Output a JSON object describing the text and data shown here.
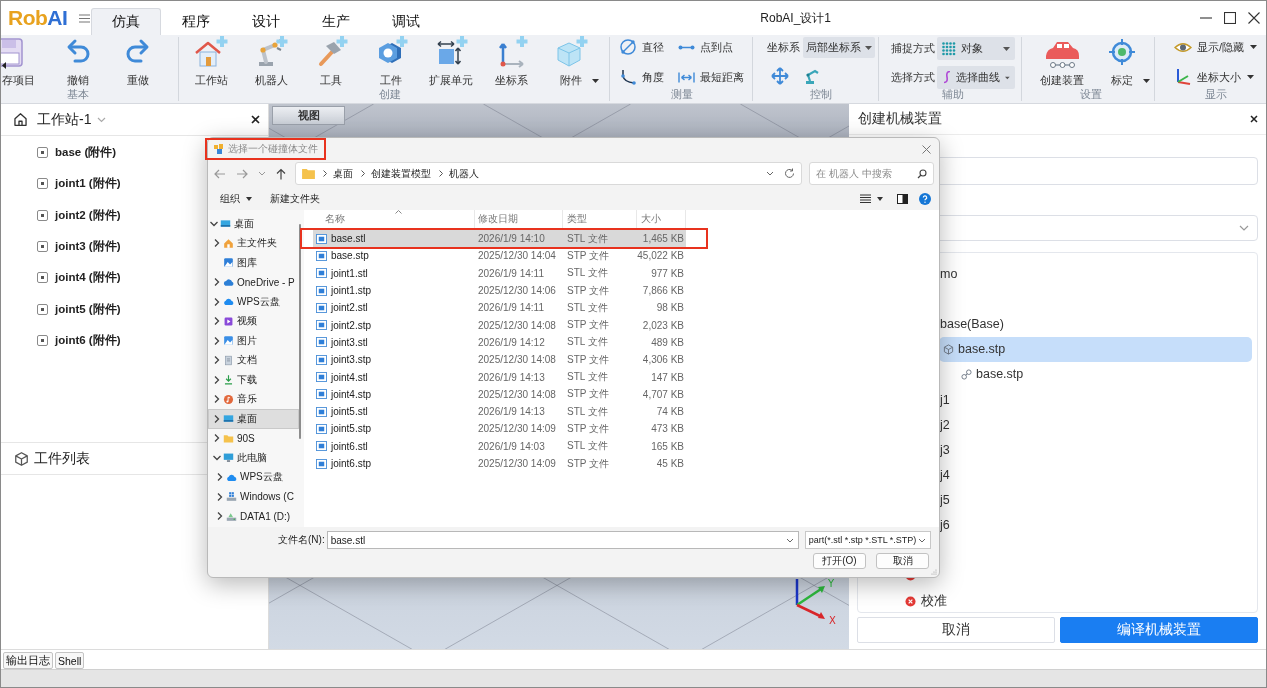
{
  "app": {
    "logo": [
      {
        "text": "Rob",
        "color": "#e8a21e"
      },
      {
        "text": "AI",
        "color": "#2f6fd4"
      }
    ],
    "title": "RobAI_设计1"
  },
  "menu_tabs": [
    {
      "label": "仿真",
      "selected": true
    },
    {
      "label": "程序",
      "selected": false
    },
    {
      "label": "设计",
      "selected": false
    },
    {
      "label": "生产",
      "selected": false
    },
    {
      "label": "调试",
      "selected": false
    }
  ],
  "ribbon": [
    {
      "label": "基本",
      "kind": "large",
      "items": [
        {
          "kind": "save",
          "label": "存项目"
        },
        {
          "kind": "undo",
          "label": "撤销"
        },
        {
          "kind": "redo",
          "label": "重做"
        }
      ]
    },
    {
      "label": "创建",
      "kind": "large",
      "items": [
        {
          "kind": "workstation",
          "label": "工作站",
          "dropdown": false
        },
        {
          "kind": "robot",
          "label": "机器人",
          "dropdown": false
        },
        {
          "kind": "tool",
          "label": "工具",
          "dropdown": false
        },
        {
          "kind": "workpiece",
          "label": "工件",
          "dropdown": false
        },
        {
          "kind": "extension",
          "label": "扩展单元",
          "dropdown": false
        },
        {
          "kind": "frame",
          "label": "坐标系",
          "dropdown": false
        },
        {
          "kind": "accessory",
          "label": "附件",
          "dropdown": true
        }
      ]
    },
    {
      "label": "测量",
      "kind": "grid",
      "items": [
        {
          "kind": "diameter",
          "label": "直径"
        },
        {
          "kind": "point",
          "label": "点到点"
        },
        {
          "kind": "angle",
          "label": "角度"
        },
        {
          "kind": "distance",
          "label": "最短距离"
        }
      ]
    },
    {
      "label": "控制",
      "kind": "control",
      "fields": [
        {
          "label": "坐标系",
          "value": "局部坐标系"
        }
      ],
      "items": [
        {
          "kind": "move"
        },
        {
          "kind": "robot-arm"
        }
      ]
    },
    {
      "label": "辅助",
      "kind": "fields",
      "fields": [
        {
          "label": "捕捉方式",
          "kind": "grid",
          "value": "对象"
        },
        {
          "label": "选择方式",
          "kind": "curve",
          "value": "选择曲线"
        }
      ]
    },
    {
      "label": "设置",
      "kind": "large",
      "items": [
        {
          "kind": "car",
          "label": "创建装置",
          "dropdown": false
        },
        {
          "kind": "target",
          "label": "标定",
          "dropdown": true
        }
      ]
    },
    {
      "label": "显示",
      "kind": "small",
      "items": [
        {
          "kind": "eye",
          "label": "显示/隐藏",
          "dropdown": true
        },
        {
          "kind": "axes",
          "label": "坐标大小",
          "dropdown": true
        }
      ]
    }
  ],
  "workstation": {
    "title": "工作站-1",
    "items": [
      {
        "label": "base (附件)"
      },
      {
        "label": "joint1 (附件)"
      },
      {
        "label": "joint2 (附件)"
      },
      {
        "label": "joint3 (附件)"
      },
      {
        "label": "joint4 (附件)"
      },
      {
        "label": "joint5 (附件)"
      },
      {
        "label": "joint6 (附件)"
      }
    ]
  },
  "parts_list": {
    "title": "工件列表"
  },
  "viewport": {
    "tab": "视图",
    "axes": {
      "y": "Y",
      "x": "X"
    }
  },
  "panel": {
    "title": "创建机械装置",
    "tree": [
      {
        "label": "mo",
        "selected": false,
        "children": [
          {
            "label": "base(Base)",
            "selected": false,
            "children": [
              {
                "label": "base.stp",
                "kind": "part",
                "selected": true,
                "children": [
                  {
                    "label": "base.stp",
                    "kind": "link",
                    "selected": false
                  }
                ]
              }
            ]
          },
          {
            "label": "j1",
            "selected": false
          },
          {
            "label": "j2",
            "selected": false
          },
          {
            "label": "j3",
            "selected": false
          },
          {
            "label": "j4",
            "selected": false
          },
          {
            "label": "j5",
            "selected": false
          },
          {
            "label": "j6",
            "selected": false
          }
        ]
      }
    ],
    "checks": [
      {
        "kind": "error"
      },
      {
        "label": "校准",
        "kind": "error"
      }
    ],
    "buttons": [
      {
        "label": "取消",
        "kind": "secondary"
      },
      {
        "label": "编译机械装置",
        "kind": "primary"
      }
    ]
  },
  "dialog": {
    "title": {
      "text": "选择一个碰撞体文件",
      "highlighted": true
    },
    "path": [
      "桌面",
      "创建装置模型",
      "机器人"
    ],
    "search": {
      "placeholder": "在 机器人 中搜索"
    },
    "toolbar": [
      {
        "label": "组织",
        "dropdown": true
      },
      {
        "label": "新建文件夹",
        "dropdown": false
      }
    ],
    "nav": [
      {
        "label": "桌面",
        "kind": "desktop",
        "expandable": true,
        "expanded": true,
        "selected": false,
        "children": [
          {
            "label": "主文件夹",
            "kind": "home",
            "expandable": true,
            "expanded": false,
            "selected": false
          },
          {
            "label": "图库",
            "kind": "gallery",
            "expandable": false,
            "selected": false
          },
          {
            "label": "OneDrive - P",
            "kind": "onedrive",
            "expandable": true,
            "expanded": false,
            "selected": false
          },
          {
            "label": "WPS云盘",
            "kind": "wps",
            "expandable": true,
            "expanded": false,
            "selected": false
          },
          {
            "label": "视频",
            "kind": "video",
            "expandable": true,
            "expanded": false,
            "selected": false
          },
          {
            "label": "图片",
            "kind": "pictures",
            "expandable": true,
            "expanded": false,
            "selected": false
          },
          {
            "label": "文档",
            "kind": "documents",
            "expandable": true,
            "expanded": false,
            "selected": false
          },
          {
            "label": "下载",
            "kind": "downloads",
            "expandable": true,
            "expanded": false,
            "selected": false
          },
          {
            "label": "音乐",
            "kind": "music",
            "expandable": true,
            "expanded": false,
            "selected": false
          },
          {
            "label": "桌面",
            "kind": "desktop",
            "expandable": true,
            "expanded": false,
            "selected": true
          },
          {
            "label": "90S",
            "kind": "folder",
            "expandable": true,
            "expanded": false,
            "selected": false
          },
          {
            "label": "此电脑",
            "kind": "computer",
            "expandable": true,
            "expanded": true,
            "selected": false,
            "children": [
              {
                "label": "WPS云盘",
                "kind": "wps",
                "expandable": true,
                "expanded": false,
                "selected": false
              },
              {
                "label": "Windows (C",
                "kind": "system-drive",
                "expandable": true,
                "expanded": false,
                "selected": false
              },
              {
                "label": "DATA1 (D:)",
                "kind": "drive",
                "expandable": true,
                "expanded": false,
                "selected": false
              }
            ]
          }
        ]
      }
    ],
    "columns": [
      {
        "label": "名称",
        "sorted": true
      },
      {
        "label": "修改日期",
        "sorted": false
      },
      {
        "label": "类型",
        "sorted": false
      },
      {
        "label": "大小",
        "sorted": false
      }
    ],
    "files": [
      {
        "name": "base.stl",
        "date": "2026/1/9 14:10",
        "type": "STL 文件",
        "size": "1,465 KB",
        "selected": true,
        "highlighted": true
      },
      {
        "name": "base.stp",
        "date": "2025/12/30 14:04",
        "type": "STP 文件",
        "size": "45,022 KB",
        "selected": false,
        "highlighted": false
      },
      {
        "name": "joint1.stl",
        "date": "2026/1/9 14:11",
        "type": "STL 文件",
        "size": "977 KB",
        "selected": false,
        "highlighted": false
      },
      {
        "name": "joint1.stp",
        "date": "2025/12/30 14:06",
        "type": "STP 文件",
        "size": "7,866 KB",
        "selected": false,
        "highlighted": false
      },
      {
        "name": "joint2.stl",
        "date": "2026/1/9 14:11",
        "type": "STL 文件",
        "size": "98 KB",
        "selected": false,
        "highlighted": false
      },
      {
        "name": "joint2.stp",
        "date": "2025/12/30 14:08",
        "type": "STP 文件",
        "size": "2,023 KB",
        "selected": false,
        "highlighted": false
      },
      {
        "name": "joint3.stl",
        "date": "2026/1/9 14:12",
        "type": "STL 文件",
        "size": "489 KB",
        "selected": false,
        "highlighted": false
      },
      {
        "name": "joint3.stp",
        "date": "2025/12/30 14:08",
        "type": "STP 文件",
        "size": "4,306 KB",
        "selected": false,
        "highlighted": false
      },
      {
        "name": "joint4.stl",
        "date": "2026/1/9 14:13",
        "type": "STL 文件",
        "size": "147 KB",
        "selected": false,
        "highlighted": false
      },
      {
        "name": "joint4.stp",
        "date": "2025/12/30 14:08",
        "type": "STP 文件",
        "size": "4,707 KB",
        "selected": false,
        "highlighted": false
      },
      {
        "name": "joint5.stl",
        "date": "2026/1/9 14:13",
        "type": "STL 文件",
        "size": "74 KB",
        "selected": false,
        "highlighted": false
      },
      {
        "name": "joint5.stp",
        "date": "2025/12/30 14:09",
        "type": "STP 文件",
        "size": "473 KB",
        "selected": false,
        "highlighted": false
      },
      {
        "name": "joint6.stl",
        "date": "2026/1/9 14:03",
        "type": "STL 文件",
        "size": "165 KB",
        "selected": false,
        "highlighted": false
      },
      {
        "name": "joint6.stp",
        "date": "2025/12/30 14:09",
        "type": "STP 文件",
        "size": "45 KB",
        "selected": false,
        "highlighted": false
      }
    ],
    "filename": {
      "label": "文件名(N):",
      "value": "base.stl"
    },
    "filter": "part(*.stl *.stp *.STL *.STP)",
    "buttons": [
      {
        "label": "打开(O)"
      },
      {
        "label": "取消"
      }
    ]
  },
  "bottom_tabs": [
    {
      "label": "输出日志"
    },
    {
      "label": "Shell"
    }
  ]
}
